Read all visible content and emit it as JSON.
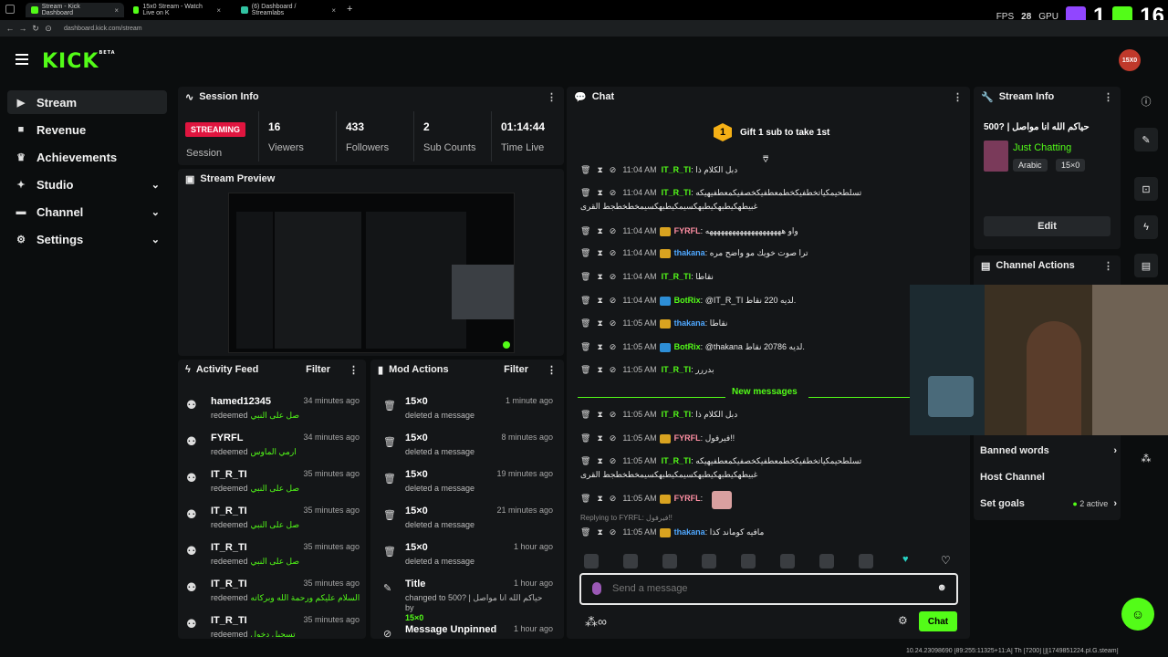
{
  "browser": {
    "tabs": [
      {
        "label": "Stream - Kick Dashboard",
        "color": "#53fc18"
      },
      {
        "label": "15x0 Stream - Watch Live on K",
        "color": "#53fc18"
      },
      {
        "label": "(6) Dashboard / Streamlabs",
        "color": "#31c3a2"
      }
    ],
    "url": "dashboard.kick.com/stream"
  },
  "overlay": {
    "fps_label": "FPS",
    "fps_value": "28",
    "gpu_label": "GPU",
    "cpu_label": "CPU 9",
    "count_1": "1",
    "count_2": "16",
    "footer_text": "10.24.23098690 [89:255:11325+11:A] Th [7200] [][1749851224.pl.G.steam]"
  },
  "header": {
    "logo": "KICK",
    "logo_badge": "BETA",
    "avatar_text": "15X0"
  },
  "sidebar": {
    "items": [
      {
        "label": "Stream",
        "icon": "video-icon"
      },
      {
        "label": "Revenue",
        "icon": "dollar-icon"
      },
      {
        "label": "Achievements",
        "icon": "trophy-icon"
      },
      {
        "label": "Studio",
        "icon": "studio-icon"
      },
      {
        "label": "Channel",
        "icon": "channel-icon"
      },
      {
        "label": "Settings",
        "icon": "gear-icon"
      }
    ]
  },
  "session": {
    "title": "Session Info",
    "status": "STREAMING",
    "status_label": "Session",
    "stats": [
      {
        "value": "16",
        "label": "Viewers"
      },
      {
        "value": "433",
        "label": "Followers"
      },
      {
        "value": "2",
        "label": "Sub Counts"
      },
      {
        "value": "01:14:44",
        "label": "Time Live"
      }
    ]
  },
  "preview": {
    "title": "Stream Preview"
  },
  "activity": {
    "title": "Activity Feed",
    "filter": "Filter",
    "rows": [
      {
        "name": "hamed12345",
        "action": "redeemed",
        "reward": "صل على النبي",
        "time": "34 minutes ago"
      },
      {
        "name": "FYRFL",
        "action": "redeemed",
        "reward": "ارمي الماوس",
        "time": "34 minutes ago"
      },
      {
        "name": "IT_R_TI",
        "action": "redeemed",
        "reward": "صل على النبي",
        "time": "35 minutes ago"
      },
      {
        "name": "IT_R_TI",
        "action": "redeemed",
        "reward": "صل على النبي",
        "time": "35 minutes ago"
      },
      {
        "name": "IT_R_TI",
        "action": "redeemed",
        "reward": "صل على النبي",
        "time": "35 minutes ago"
      },
      {
        "name": "IT_R_TI",
        "action": "redeemed",
        "reward": "السلام عليكم ورحمة الله وبركاته",
        "time": "35 minutes ago"
      },
      {
        "name": "IT_R_TI",
        "action": "redeemed",
        "reward": "تسجيل دخول",
        "time": "35 minutes ago"
      }
    ]
  },
  "mod": {
    "title": "Mod Actions",
    "filter": "Filter",
    "rows": [
      {
        "name": "15×0",
        "action": "deleted a message",
        "time": "1 minute ago"
      },
      {
        "name": "15×0",
        "action": "deleted a message",
        "time": "8 minutes ago"
      },
      {
        "name": "15×0",
        "action": "deleted a message",
        "time": "19 minutes ago"
      },
      {
        "name": "15×0",
        "action": "deleted a message",
        "time": "21 minutes ago"
      },
      {
        "name": "15×0",
        "action": "deleted a message",
        "time": "1 hour ago"
      }
    ],
    "title_row": {
      "name": "Title",
      "line1": "changed to 500? | حياكم الله انا مواصل by",
      "line2": "15×0",
      "time": "1 hour ago"
    },
    "unpin_row": {
      "name": "Message Unpinned",
      "time": "1 hour ago"
    }
  },
  "chat": {
    "title": "Chat",
    "gift_text": "Gift 1 sub to take 1st",
    "new_messages": "New messages",
    "lines": [
      {
        "time": "11:04 AM",
        "user": "IT_R_TI",
        "color": "#53fc18",
        "badge": "",
        "msg": "دبل الكلام ذا"
      },
      {
        "time": "11:04 AM",
        "user": "IT_R_TI",
        "color": "#53fc18",
        "badge": "",
        "msg": "تسلطحيمكياتخطفيكخطمعطفيكخصفيكمعطفيهيكه",
        "msg2": "غبيطهكيطبهكيطبهكسيمكيطبهكسيمخطخطجط القرى"
      },
      {
        "time": "11:04 AM",
        "user": "FYRFL",
        "color": "#ff8fa3",
        "badge": "crown",
        "msg": "واو ههههههههههههههههههههه"
      },
      {
        "time": "11:04 AM",
        "user": "thakana",
        "color": "#4fa8ff",
        "badge": "crown",
        "msg": "ترا صوت خويك مو واضح مره"
      },
      {
        "time": "11:04 AM",
        "user": "IT_R_TI",
        "color": "#53fc18",
        "badge": "",
        "msg": "نقاطا"
      },
      {
        "time": "11:04 AM",
        "user": "BotRix",
        "color": "#53fc18",
        "badge": "bot",
        "msg": "@IT_R_TI لديه 220 نقاط."
      },
      {
        "time": "11:05 AM",
        "user": "thakana",
        "color": "#4fa8ff",
        "badge": "crown",
        "msg": "نقاطا"
      },
      {
        "time": "11:05 AM",
        "user": "BotRix",
        "color": "#53fc18",
        "badge": "bot",
        "msg": "@thakana لديه 20786 نقاط."
      },
      {
        "time": "11:05 AM",
        "user": "IT_R_TI",
        "color": "#53fc18",
        "badge": "",
        "msg": "بدررر"
      },
      {
        "time": "11:05 AM",
        "user": "IT_R_TI",
        "color": "#53fc18",
        "badge": "",
        "msg": "دبل الكلام ذا"
      },
      {
        "time": "11:05 AM",
        "user": "FYRFL",
        "color": "#ff8fa3",
        "badge": "crown",
        "msg": "فيرفول!!"
      },
      {
        "time": "11:05 AM",
        "user": "IT_R_TI",
        "color": "#53fc18",
        "badge": "",
        "msg": "تسلطحيمكياتخطفيكخطمعطفيكخصفيكمعطفيهيكه",
        "msg2": "غبيطهكيطبهكيطبهكسيمكيطبهكسيمخطخطجط القرى"
      },
      {
        "time": "11:05 AM",
        "user": "FYRFL",
        "color": "#ff8fa3",
        "badge": "crown",
        "msg": ""
      },
      {
        "time": "11:05 AM",
        "user": "thakana",
        "color": "#4fa8ff",
        "badge": "crown",
        "msg": "مافيه كوماند كذا",
        "reply": "Replying to FYRFL: فيرفول!!"
      }
    ],
    "input_placeholder": "Send a message",
    "send_label": "Chat"
  },
  "stream_info": {
    "title": "Stream Info",
    "stream_title": "500? | حياكم الله انا مواصل",
    "category": "Just Chatting",
    "tags": [
      "Arabic",
      "15×0"
    ],
    "edit_label": "Edit"
  },
  "channel_actions": {
    "title": "Channel Actions",
    "items": [
      {
        "label": "Banned words"
      },
      {
        "label": "Host Channel"
      },
      {
        "label": "Set goals",
        "extra": "2 active"
      }
    ]
  },
  "colors": {
    "accent": "#53fc18",
    "streaming": "#e0153f",
    "panel": "#141618"
  }
}
